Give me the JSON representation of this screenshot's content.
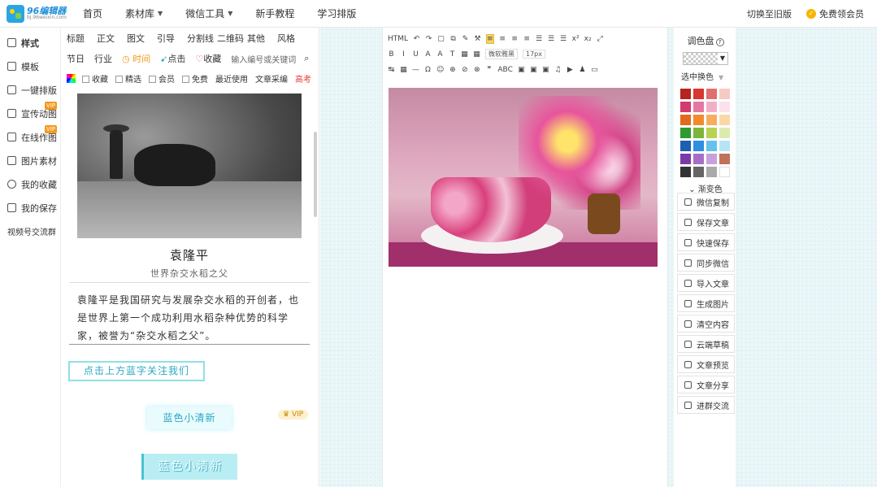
{
  "logo": {
    "title": "96编辑器",
    "sub": "bj.96weixin.com"
  },
  "nav": {
    "items": [
      {
        "label": "首页",
        "caret": false
      },
      {
        "label": "素材库",
        "caret": true
      },
      {
        "label": "微信工具",
        "caret": true
      },
      {
        "label": "新手教程",
        "caret": false
      },
      {
        "label": "学习排版",
        "caret": false
      }
    ],
    "switch_old": "切换至旧版",
    "free_vip": "免费领会员"
  },
  "sidebar": {
    "items": [
      {
        "label": "样式",
        "icon": "grid-icon",
        "active": true,
        "vip": false
      },
      {
        "label": "模板",
        "icon": "template-icon",
        "active": false,
        "vip": false
      },
      {
        "label": "一键排版",
        "icon": "auto-layout-icon",
        "active": false,
        "vip": false
      },
      {
        "label": "宣传动图",
        "icon": "gif-icon",
        "active": false,
        "vip": true
      },
      {
        "label": "在线作图",
        "icon": "design-icon",
        "active": false,
        "vip": true
      },
      {
        "label": "图片素材",
        "icon": "image-icon",
        "active": false,
        "vip": false
      },
      {
        "label": "我的收藏",
        "icon": "heart-icon",
        "active": false,
        "vip": false
      },
      {
        "label": "我的保存",
        "icon": "save-icon",
        "active": false,
        "vip": false
      }
    ],
    "vip_label": "VIP",
    "extra": "视频号交流群"
  },
  "panel": {
    "tabs": [
      "标题",
      "正文",
      "图文",
      "引导",
      "分割线",
      "二维码",
      "其他",
      "风格"
    ],
    "tabs2": [
      "节日",
      "行业"
    ],
    "time_label": "时间",
    "like_label": "点击",
    "fav_label": "收藏",
    "search_placeholder": "输入编号或关键词",
    "filters": [
      "收藏",
      "精选",
      "会员",
      "免费"
    ],
    "recent": "最近使用",
    "article": "文章采编",
    "exam": "高考",
    "card": {
      "title": "袁隆平",
      "subtitle": "世界杂交水稻之父",
      "body": "袁隆平是我国研究与发展杂交水稻的开创者，也是世界上第一个成功利用水稻杂种优势的科学家，被誉为“杂交水稻之父”。"
    },
    "follow_text": "点击上方蓝字关注我们",
    "vip_chip": "VIP",
    "fresh1": "蓝色小清新",
    "fresh2": "蓝色小清新"
  },
  "editor": {
    "toolbar_row1": [
      "HTML",
      "↶",
      "↷",
      "▢",
      "⧉",
      "✎",
      "⚒",
      "≡",
      "≡",
      "≡",
      "≡",
      "☰",
      "☰",
      "☰",
      "x²",
      "x₂",
      "⤢"
    ],
    "toolbar_row2": [
      "B",
      "I",
      "U",
      "A",
      "A",
      "T",
      "▦",
      "▦"
    ],
    "font_name": "微软雅黑",
    "font_size": "17px",
    "toolbar_row3": [
      "↹",
      "▦",
      "—",
      "Ω",
      "☺",
      "⊕",
      "⊘",
      "⊗",
      "❞",
      "ABC",
      "▣",
      "▣",
      "▣",
      "♫",
      "▶",
      "♟",
      "▭"
    ]
  },
  "palette": {
    "title": "调色盘",
    "select_label": "选中换色",
    "gradient_label": "渐变色",
    "colors": [
      "#b5241f",
      "#d8362f",
      "#e07070",
      "#f7c9c4",
      "#d43a6d",
      "#e578a0",
      "#f2b0c8",
      "#fbe1ea",
      "#e26a1e",
      "#f28a2e",
      "#f6ad62",
      "#fbd7a7",
      "#2f9a2f",
      "#7cb53b",
      "#b8d350",
      "#dcebb0",
      "#1f5fb0",
      "#2e8fe0",
      "#66c1ec",
      "#b7e4f5",
      "#7a3aa6",
      "#a56fc7",
      "#c6a1dc",
      "#c0725a",
      "#333333",
      "#666666",
      "#aaaaaa",
      "#ffffff"
    ],
    "actions": [
      {
        "label": "微信复制",
        "icon": "copy-icon"
      },
      {
        "label": "保存文章",
        "icon": "save-icon"
      },
      {
        "label": "快速保存",
        "icon": "flash-icon"
      },
      {
        "label": "同步微信",
        "icon": "sync-icon"
      },
      {
        "label": "导入文章",
        "icon": "import-icon"
      },
      {
        "label": "生成图片",
        "icon": "image-icon"
      },
      {
        "label": "清空内容",
        "icon": "trash-icon"
      },
      {
        "label": "云端草稿",
        "icon": "cloud-icon"
      },
      {
        "label": "文章预览",
        "icon": "eye-icon"
      },
      {
        "label": "文章分享",
        "icon": "share-icon"
      },
      {
        "label": "进群交流",
        "icon": "group-icon"
      }
    ]
  }
}
